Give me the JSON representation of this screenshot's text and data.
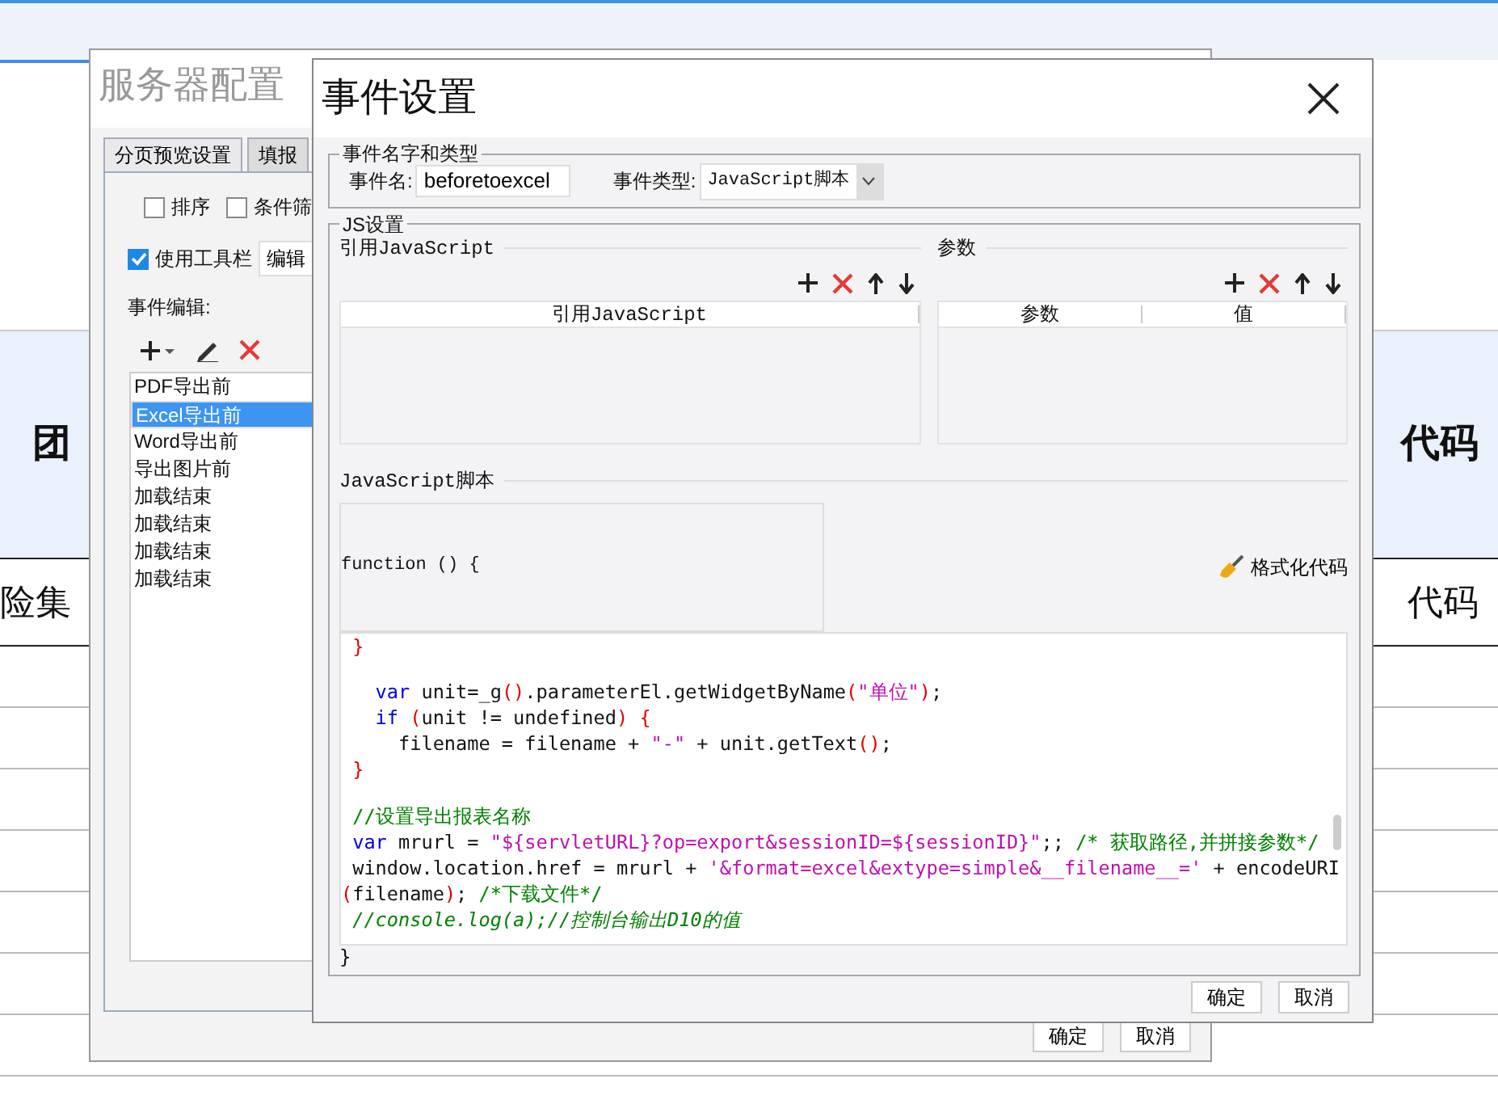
{
  "background_table": {
    "rows": [
      {
        "left": "团",
        "right": "代码",
        "header": true
      },
      {
        "left": "险集",
        "right": "代码",
        "header": false
      }
    ]
  },
  "server_config_window": {
    "title": "服务器配置",
    "tabs": [
      {
        "label": "分页预览设置",
        "selected": true
      },
      {
        "label": "填报",
        "selected": false
      }
    ],
    "options": [
      {
        "label": "排序",
        "checked": false
      },
      {
        "label": "条件筛",
        "checked": false
      }
    ],
    "toolbar_option": {
      "label": "使用工具栏",
      "checked": true,
      "button": "编辑"
    },
    "event_label": "事件编辑:",
    "events": [
      {
        "label": "PDF导出前",
        "selected": false
      },
      {
        "label": "Excel导出前",
        "selected": true
      },
      {
        "label": "Word导出前",
        "selected": false
      },
      {
        "label": "导出图片前",
        "selected": false
      },
      {
        "label": "加载结束",
        "selected": false
      },
      {
        "label": "加载结束",
        "selected": false
      },
      {
        "label": "加载结束",
        "selected": false
      },
      {
        "label": "加载结束",
        "selected": false
      }
    ],
    "buttons": [
      "确定",
      "取消"
    ]
  },
  "event_dialog": {
    "title": "事件设置",
    "name_group": {
      "title": "事件名字和类型",
      "name_label": "事件名:",
      "name_value": "beforetoexcel",
      "type_label": "事件类型:",
      "type_value": "JavaScript脚本"
    },
    "js_group": {
      "title": "JS设置",
      "ref_section": {
        "title": "引用JavaScript",
        "columns": [
          "引用JavaScript"
        ]
      },
      "param_section": {
        "title": "参数",
        "columns": [
          "参数",
          "值"
        ]
      },
      "script_title": "JavaScript脚本",
      "function_header": "function () {",
      "format_button": "格式化代码",
      "code_lines": [
        {
          "gap_before": false,
          "tokens": [
            {
              "t": " }",
              "kind": "brace"
            }
          ]
        },
        {
          "gap_before": true,
          "tokens": [
            {
              "t": "   var",
              "kind": "keyword"
            },
            {
              "t": " unit=_g",
              "kind": "plain"
            },
            {
              "t": "()",
              "kind": "brace"
            },
            {
              "t": ".parameterEl.getWidgetByName",
              "kind": "plain"
            },
            {
              "t": "(",
              "kind": "brace"
            },
            {
              "t": "\"单位\"",
              "kind": "string"
            },
            {
              "t": ")",
              "kind": "brace"
            },
            {
              "t": ";",
              "kind": "plain"
            }
          ]
        },
        {
          "gap_before": false,
          "tokens": [
            {
              "t": "   if",
              "kind": "keyword"
            },
            {
              "t": " (",
              "kind": "brace"
            },
            {
              "t": "unit != undefined",
              "kind": "plain"
            },
            {
              "t": ")",
              "kind": "brace"
            },
            {
              "t": " {",
              "kind": "brace"
            }
          ]
        },
        {
          "gap_before": false,
          "tokens": [
            {
              "t": "     filename = filename + ",
              "kind": "plain"
            },
            {
              "t": "\"-\"",
              "kind": "string"
            },
            {
              "t": " + unit.getText",
              "kind": "plain"
            },
            {
              "t": "()",
              "kind": "brace"
            },
            {
              "t": ";",
              "kind": "plain"
            }
          ]
        },
        {
          "gap_before": false,
          "tokens": [
            {
              "t": " }",
              "kind": "brace"
            }
          ]
        },
        {
          "gap_before": true,
          "tokens": [
            {
              "t": " //设置导出报表名称",
              "kind": "comment"
            }
          ]
        },
        {
          "gap_before": false,
          "tokens": [
            {
              "t": " var",
              "kind": "keyword"
            },
            {
              "t": " mrurl = ",
              "kind": "plain"
            },
            {
              "t": "\"${servletURL}?op=export&sessionID=${sessionID}\"",
              "kind": "string"
            },
            {
              "t": ";; ",
              "kind": "plain"
            },
            {
              "t": "/* 获取路径,并拼接参数*/",
              "kind": "comment"
            }
          ]
        },
        {
          "gap_before": false,
          "tokens": [
            {
              "t": " window.location.href = mrurl + ",
              "kind": "plain"
            },
            {
              "t": "'&format=excel&extype=simple&__filename__='",
              "kind": "string"
            },
            {
              "t": " + encodeURI",
              "kind": "plain"
            }
          ]
        },
        {
          "gap_before": false,
          "tokens": [
            {
              "t": "(",
              "kind": "brace"
            },
            {
              "t": "filename",
              "kind": "plain"
            },
            {
              "t": ")",
              "kind": "brace"
            },
            {
              "t": "; ",
              "kind": "plain"
            },
            {
              "t": "/*下载文件*/",
              "kind": "comment"
            }
          ]
        },
        {
          "gap_before": false,
          "tokens": [
            {
              "t": " //console.log(a);//控制台输出D10的值",
              "kind": "comment_italic"
            }
          ]
        }
      ],
      "closing": "}"
    },
    "buttons": [
      "确定",
      "取消"
    ]
  }
}
